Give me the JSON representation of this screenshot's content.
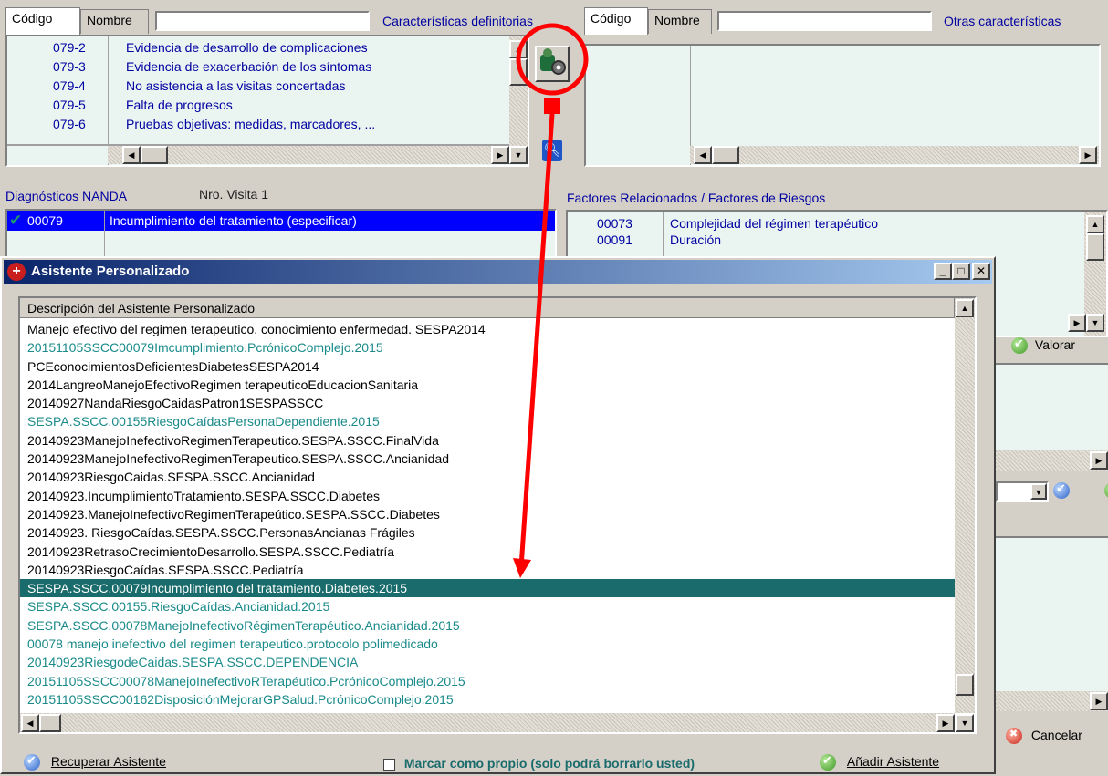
{
  "top_left": {
    "tab_code": "Código",
    "tab_name": "Nombre",
    "search_value": "",
    "section_title": "Características definitorias",
    "rows": [
      {
        "code": "079-2",
        "desc": "Evidencia de desarrollo de complicaciones"
      },
      {
        "code": "079-3",
        "desc": "Evidencia de exacerbación de los síntomas"
      },
      {
        "code": "079-4",
        "desc": "No asistencia a las visitas concertadas"
      },
      {
        "code": "079-5",
        "desc": "Falta de progresos"
      },
      {
        "code": "079-6",
        "desc": "Pruebas objetivas: medidas, marcadores, ..."
      }
    ]
  },
  "top_right": {
    "tab_code": "Código",
    "tab_name": "Nombre",
    "search_value": "",
    "section_title": "Otras características"
  },
  "nanda": {
    "title": "Diagnósticos NANDA",
    "visit": "Nro. Visita 1",
    "selected_code": "00079",
    "selected_desc": "Incumplimiento del tratamiento (especificar)"
  },
  "factors": {
    "title": "Factores Relacionados / Factores de Riesgos",
    "rows": [
      {
        "code": "00073",
        "desc": "Complejidad del régimen terapéutico"
      },
      {
        "code": "00091",
        "desc": "Duración"
      }
    ]
  },
  "side": {
    "valorar": "Valorar",
    "cancelar": "Cancelar"
  },
  "dialog": {
    "title": "Asistente Personalizado",
    "column_header": "Descripción del Asistente Personalizado",
    "items": [
      {
        "text": "Manejo efectivo del regimen terapeutico. conocimiento enfermedad. SESPA2014",
        "color": "black"
      },
      {
        "text": "20151105SSCC00079Imcumplimiento.PcrónicoComplejo.2015",
        "color": "teal"
      },
      {
        "text": "PCEconocimientosDeficientesDiabetesSESPA2014",
        "color": "black"
      },
      {
        "text": "2014LangreoManejoEfectivoRegimen terapeuticoEducacionSanitaria",
        "color": "black"
      },
      {
        "text": "20140927NandaRiesgoCaidasPatron1SESPASSCC",
        "color": "black"
      },
      {
        "text": "SESPA.SSCC.00155RiesgoCaídasPersonaDependiente.2015",
        "color": "teal"
      },
      {
        "text": "20140923ManejoInefectivoRegimenTerapeutico.SESPA.SSCC.FinalVida",
        "color": "black"
      },
      {
        "text": "20140923ManejoInefectivoRegimenTerapeutico.SESPA.SSCC.Ancianidad",
        "color": "black"
      },
      {
        "text": "20140923RiesgoCaidas.SESPA.SSCC.Ancianidad",
        "color": "black"
      },
      {
        "text": "20140923.IncumplimientoTratamiento.SESPA.SSCC.Diabetes",
        "color": "black"
      },
      {
        "text": "20140923.ManejoInefectivoRegimenTerapeútico.SESPA.SSCC.Diabetes",
        "color": "black"
      },
      {
        "text": "20140923. RiesgoCaídas.SESPA.SSCC.PersonasAncianas Frágiles",
        "color": "black"
      },
      {
        "text": "20140923RetrasoCrecimientoDesarrollo.SESPA.SSCC.Pediatría",
        "color": "black"
      },
      {
        "text": "20140923RiesgoCaídas.SESPA.SSCC.Pediatría",
        "color": "black"
      },
      {
        "text": "SESPA.SSCC.00079Incumplimiento del tratamiento.Diabetes.2015",
        "color": "selected"
      },
      {
        "text": "SESPA.SSCC.00155.RiesgoCaídas.Ancianidad.2015",
        "color": "teal"
      },
      {
        "text": "SESPA.SSCC.00078ManejoInefectivoRégimenTerapéutico.Ancianidad.2015",
        "color": "teal"
      },
      {
        "text": "00078 manejo inefectivo del regimen terapeutico.protocolo polimedicado",
        "color": "teal"
      },
      {
        "text": "20140923RiesgodeCaidas.SESPA.SSCC.DEPENDENCIA",
        "color": "teal"
      },
      {
        "text": "20151105SSCC00078ManejoInefectivoRTerapéutico.PcrónicoComplejo.2015",
        "color": "teal"
      },
      {
        "text": "20151105SSCC00162DisposiciónMejorarGPSalud.PcrónicoComplejo.2015",
        "color": "teal"
      }
    ],
    "recover_label": "Recuperar Asistente",
    "own_label": "Marcar como propio (solo podrá borrarlo usted)",
    "add_label": "Añadir Asistente"
  },
  "annotation_color": "#ff0000",
  "selection_color": "#1a6b6b",
  "titlebar_color": "#0a246a"
}
